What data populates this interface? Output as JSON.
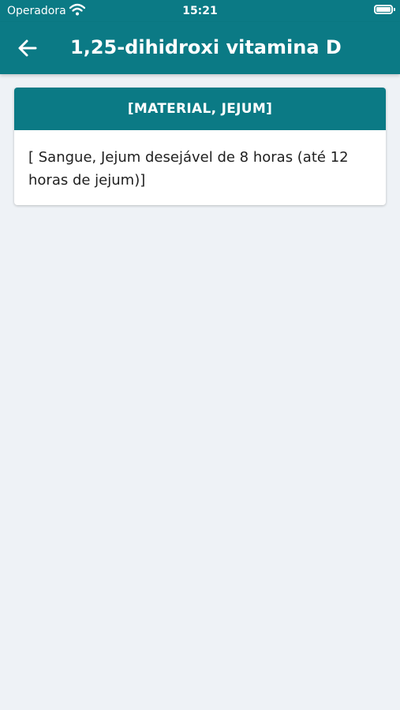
{
  "status_bar": {
    "carrier": "Operadora",
    "time": "15:21",
    "icons": [
      "wifi-icon",
      "battery-icon"
    ]
  },
  "app_bar": {
    "title": "1,25-dihidroxi vitamina D",
    "back_icon": "arrow-left-icon"
  },
  "card": {
    "header": "[MATERIAL, JEJUM]",
    "body": "[ Sangue,  Jejum desejável de 8 horas (até 12 horas de jejum)]"
  },
  "colors": {
    "primary": "#0b7a85",
    "background": "#eef2f6",
    "card": "#ffffff",
    "text": "#1f1f1f"
  }
}
